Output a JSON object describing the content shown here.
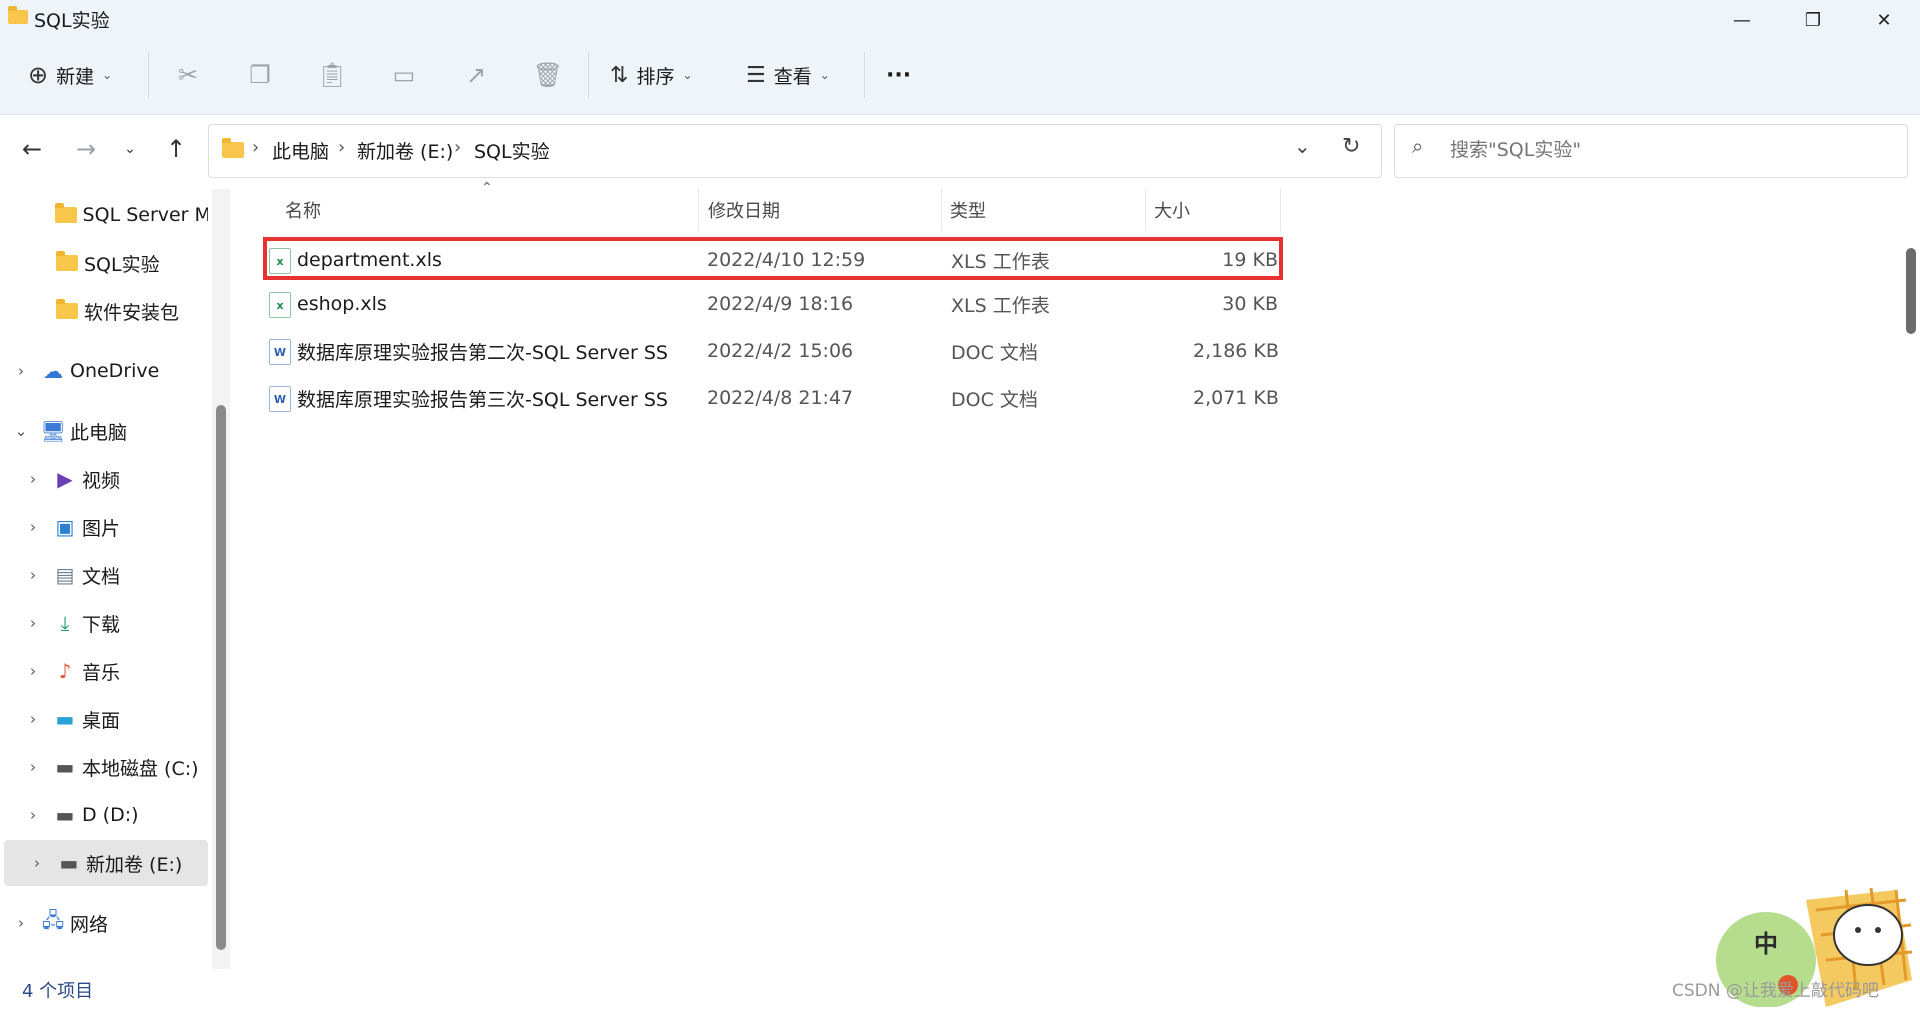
{
  "window": {
    "title": "SQL实验",
    "controls": {
      "minimize": "—",
      "maximize": "❐",
      "close": "✕"
    }
  },
  "toolbar": {
    "new_label": "新建",
    "sort_label": "排序",
    "view_label": "查看",
    "more_label": "···"
  },
  "address": {
    "crumbs": [
      "此电脑",
      "新加卷 (E:)",
      "SQL实验"
    ]
  },
  "search": {
    "placeholder": "搜索\"SQL实验\""
  },
  "sidebar": {
    "items": [
      {
        "label": "SQL Server Ma",
        "icon": "folder-icon",
        "expandable": false
      },
      {
        "label": "SQL实验",
        "icon": "folder-icon",
        "expandable": false
      },
      {
        "label": "软件安装包",
        "icon": "folder-icon",
        "expandable": false
      },
      {
        "label": "OneDrive",
        "icon": "cloud-icon",
        "expandable": true
      },
      {
        "label": "此电脑",
        "icon": "computer-icon",
        "expandable": true,
        "expanded": true
      },
      {
        "label": "视频",
        "icon": "video-icon",
        "expandable": true
      },
      {
        "label": "图片",
        "icon": "pictures-icon",
        "expandable": true
      },
      {
        "label": "文档",
        "icon": "documents-icon",
        "expandable": true
      },
      {
        "label": "下载",
        "icon": "download-icon",
        "expandable": true
      },
      {
        "label": "音乐",
        "icon": "music-icon",
        "expandable": true
      },
      {
        "label": "桌面",
        "icon": "desktop-icon",
        "expandable": true
      },
      {
        "label": "本地磁盘 (C:)",
        "icon": "drive-icon",
        "expandable": true
      },
      {
        "label": "D (D:)",
        "icon": "drive-icon",
        "expandable": true
      },
      {
        "label": "新加卷 (E:)",
        "icon": "drive-icon",
        "expandable": true,
        "selected": true
      },
      {
        "label": "网络",
        "icon": "network-icon",
        "expandable": true
      }
    ]
  },
  "file_list": {
    "columns": [
      "名称",
      "修改日期",
      "类型",
      "大小"
    ],
    "rows": [
      {
        "name": "department.xls",
        "modified": "2022/4/10 12:59",
        "type": "XLS 工作表",
        "size": "19 KB",
        "icon": "xls-file-icon",
        "highlighted": true
      },
      {
        "name": "eshop.xls",
        "modified": "2022/4/9 18:16",
        "type": "XLS 工作表",
        "size": "30 KB",
        "icon": "xls-file-icon"
      },
      {
        "name": "数据库原理实验报告第二次-SQL Server SSMS...",
        "modified": "2022/4/2 15:06",
        "type": "DOC 文档",
        "size": "2,186 KB",
        "icon": "doc-file-icon"
      },
      {
        "name": "数据库原理实验报告第三次-SQL Server SSMS...",
        "modified": "2022/4/8 21:47",
        "type": "DOC 文档",
        "size": "2,071 KB",
        "icon": "doc-file-icon"
      }
    ]
  },
  "status": {
    "item_count": "4 个项目"
  },
  "watermark": {
    "text": "CSDN @让我爱上敲代码吧",
    "mascot_char": "中"
  },
  "colors": {
    "highlight": "#e63232",
    "folder": "#f8c64a",
    "titlebar": "#eff4f9"
  }
}
